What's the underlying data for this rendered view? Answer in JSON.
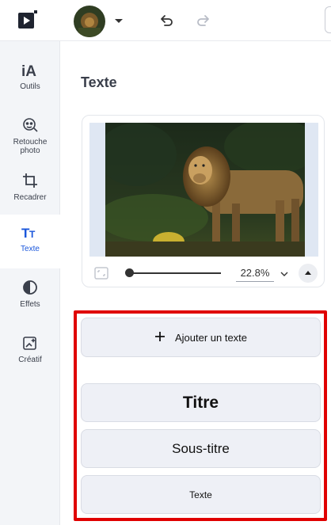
{
  "topbar": {
    "logo_icon": "play-logo-icon",
    "avatar_icon": "lion-avatar",
    "caret_icon": "chevron-down-icon",
    "undo_icon": "undo-icon",
    "redo_icon": "redo-icon"
  },
  "sidebar": {
    "items": [
      {
        "label": "Outils",
        "icon": "ai-icon"
      },
      {
        "label": "Retouche photo",
        "icon": "face-retouch-icon"
      },
      {
        "label": "Recadrer",
        "icon": "crop-icon"
      },
      {
        "label": "Texte",
        "icon": "text-icon"
      },
      {
        "label": "Effets",
        "icon": "contrast-icon"
      },
      {
        "label": "Créatif",
        "icon": "sparkle-image-icon"
      }
    ],
    "active_color": "#1a56db"
  },
  "panel": {
    "title": "Texte"
  },
  "preview": {
    "zoom": "22.8%",
    "slider_fraction": 0.0
  },
  "text_actions": {
    "add_label": "Ajouter un texte",
    "title_label": "Titre",
    "subtitle_label": "Sous-titre",
    "body_label": "Texte",
    "highlight_color": "#e00000"
  }
}
